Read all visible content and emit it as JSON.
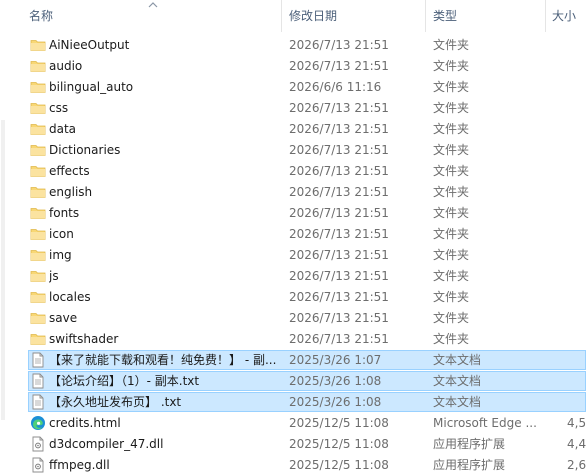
{
  "columns": {
    "name": "名称",
    "modified": "修改日期",
    "type": "类型",
    "size": "大小"
  },
  "rows": [
    {
      "name": "AiNieeOutput",
      "date": "2026/7/13 21:51",
      "type": "文件夹",
      "size": "",
      "icon": "folder-icon",
      "selected": false
    },
    {
      "name": "audio",
      "date": "2026/7/13 21:51",
      "type": "文件夹",
      "size": "",
      "icon": "folder-icon",
      "selected": false
    },
    {
      "name": "bilingual_auto",
      "date": "2026/6/6 11:16",
      "type": "文件夹",
      "size": "",
      "icon": "folder-icon",
      "selected": false
    },
    {
      "name": "css",
      "date": "2026/7/13 21:51",
      "type": "文件夹",
      "size": "",
      "icon": "folder-icon",
      "selected": false
    },
    {
      "name": "data",
      "date": "2026/7/13 21:51",
      "type": "文件夹",
      "size": "",
      "icon": "folder-icon",
      "selected": false
    },
    {
      "name": "Dictionaries",
      "date": "2026/7/13 21:51",
      "type": "文件夹",
      "size": "",
      "icon": "folder-icon",
      "selected": false
    },
    {
      "name": "effects",
      "date": "2026/7/13 21:51",
      "type": "文件夹",
      "size": "",
      "icon": "folder-icon",
      "selected": false
    },
    {
      "name": "english",
      "date": "2026/7/13 21:51",
      "type": "文件夹",
      "size": "",
      "icon": "folder-icon",
      "selected": false
    },
    {
      "name": "fonts",
      "date": "2026/7/13 21:51",
      "type": "文件夹",
      "size": "",
      "icon": "folder-icon",
      "selected": false
    },
    {
      "name": "icon",
      "date": "2026/7/13 21:51",
      "type": "文件夹",
      "size": "",
      "icon": "folder-icon",
      "selected": false
    },
    {
      "name": "img",
      "date": "2026/7/13 21:51",
      "type": "文件夹",
      "size": "",
      "icon": "folder-icon",
      "selected": false
    },
    {
      "name": "js",
      "date": "2026/7/13 21:51",
      "type": "文件夹",
      "size": "",
      "icon": "folder-icon",
      "selected": false
    },
    {
      "name": "locales",
      "date": "2026/7/13 21:51",
      "type": "文件夹",
      "size": "",
      "icon": "folder-icon",
      "selected": false
    },
    {
      "name": "save",
      "date": "2026/7/13 21:51",
      "type": "文件夹",
      "size": "",
      "icon": "folder-icon",
      "selected": false
    },
    {
      "name": "swiftshader",
      "date": "2026/7/13 21:51",
      "type": "文件夹",
      "size": "",
      "icon": "folder-icon",
      "selected": false
    },
    {
      "name": "【来了就能下载和观看！纯免费！】 - 副...",
      "date": "2025/3/26 1:07",
      "type": "文本文档",
      "size": "",
      "icon": "text-file-icon",
      "selected": true
    },
    {
      "name": "【论坛介绍】（1）- 副本.txt",
      "date": "2025/3/26 1:08",
      "type": "文本文档",
      "size": "",
      "icon": "text-file-icon",
      "selected": true
    },
    {
      "name": "【永久地址发布页】 .txt",
      "date": "2025/3/26 1:08",
      "type": "文本文档",
      "size": "",
      "icon": "text-file-icon",
      "selected": true
    },
    {
      "name": "credits.html",
      "date": "2025/12/5 11:08",
      "type": "Microsoft Edge ...",
      "size": "4,5",
      "icon": "edge-icon",
      "selected": false
    },
    {
      "name": "d3dcompiler_47.dll",
      "date": "2025/12/5 11:08",
      "type": "应用程序扩展",
      "size": "4,4",
      "icon": "dll-file-icon",
      "selected": false
    },
    {
      "name": "ffmpeg.dll",
      "date": "2025/12/5 11:08",
      "type": "应用程序扩展",
      "size": "2,6",
      "icon": "dll-file-icon",
      "selected": false
    }
  ],
  "colors": {
    "header_text": "#4c607a",
    "folder": "#f8d775",
    "selection_bg": "#cce8ff",
    "selection_border": "#99d1ff"
  }
}
